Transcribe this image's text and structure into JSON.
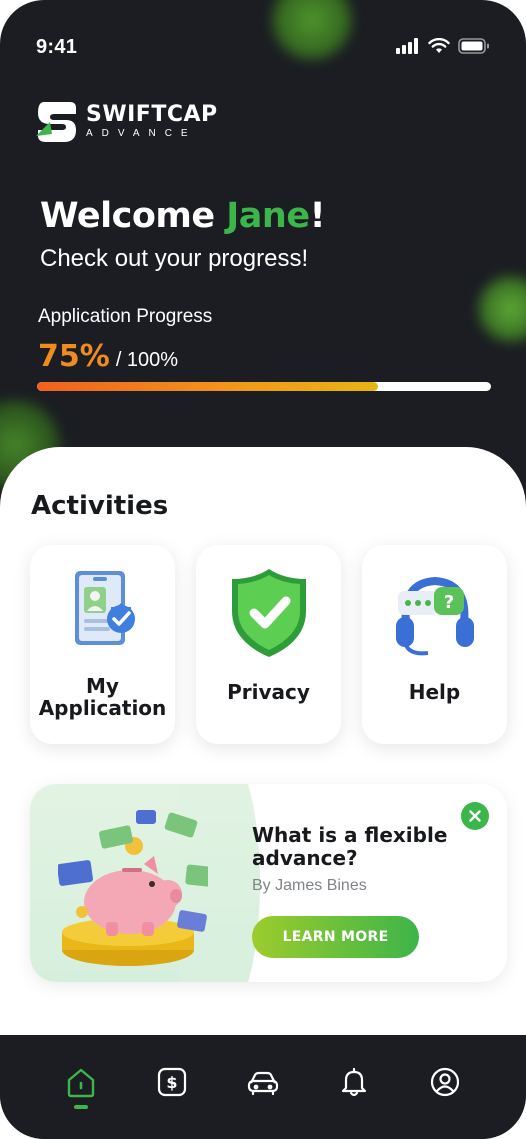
{
  "status_bar": {
    "time": "9:41"
  },
  "brand": {
    "name": "SWIFTCAP",
    "tagline": "ADVANCE"
  },
  "greeting": {
    "prefix": "Welcome ",
    "name": "Jane",
    "suffix": "!",
    "subtitle": "Check out your progress!"
  },
  "progress": {
    "label": "Application Progress",
    "value": "75%",
    "total": "/ 100%",
    "fraction": 0.75
  },
  "activities": {
    "title": "Activities",
    "items": [
      {
        "label_line1": "My",
        "label_line2": "Application",
        "icon": "id-card-icon"
      },
      {
        "label": "Privacy",
        "icon": "shield-check-icon"
      },
      {
        "label": "Help",
        "icon": "headset-chat-icon"
      }
    ]
  },
  "promo": {
    "title": "What is a flexible advance?",
    "author": "By James Bines",
    "button": "LEARN MORE",
    "image": "piggy-bank-cash-icon"
  },
  "nav": {
    "items": [
      {
        "icon": "home-icon",
        "active": true
      },
      {
        "icon": "dollar-icon",
        "active": false
      },
      {
        "icon": "car-icon",
        "active": false
      },
      {
        "icon": "bell-icon",
        "active": false
      },
      {
        "icon": "profile-icon",
        "active": false
      }
    ]
  },
  "colors": {
    "accent_green": "#3cb54a",
    "progress_orange": "#f08c1f",
    "dark_bg": "#1b1d22"
  }
}
